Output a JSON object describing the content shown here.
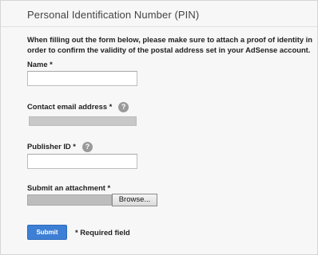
{
  "form": {
    "title": "Personal Identification Number (PIN)",
    "intro": "When filling out the form below, please make sure to attach a proof of identity in order to confirm the validity of the postal address set in your AdSense account.",
    "name_label": "Name *",
    "name_value": "",
    "email_label": "Contact email address *",
    "publisher_label": "Publisher ID *",
    "publisher_value": "",
    "attachment_label": "Submit an attachment *",
    "browse_label": "Browse...",
    "submit_label": "Submit",
    "required_note": "* Required field",
    "help_icon": "?"
  },
  "colors": {
    "submit_bg": "#3c7fd4",
    "page_bg": "#f7f7f7",
    "help_icon_bg": "#9a9a9a"
  }
}
